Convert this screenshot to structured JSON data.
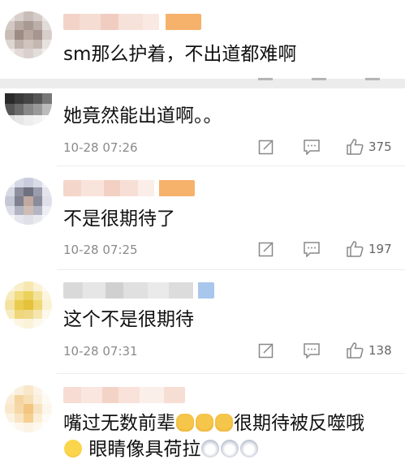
{
  "comments": [
    {
      "text": "sm那么护着，不出道都难啊",
      "time": "",
      "likes": ""
    },
    {
      "text": "她竟然能出道啊。。",
      "time": "10-28 07:26",
      "likes": "375"
    },
    {
      "text": "不是很期待了",
      "time": "10-28 07:25",
      "likes": "197"
    },
    {
      "text": "这个不是很期待",
      "time": "10-28 07:31",
      "likes": "138"
    },
    {
      "text_line1": "嘴过无数前辈",
      "text_line1_after": "很期待被反噬哦",
      "text_line2_after": "眼睛像具荷拉"
    }
  ],
  "icons": {
    "edit": "edit-icon",
    "comment": "comment-icon",
    "like": "thumbs-up-icon"
  },
  "colors": {
    "text": "#111111",
    "meta": "#8a8a8a",
    "divider": "#ececec",
    "blur_orange": "#f6b26b"
  }
}
